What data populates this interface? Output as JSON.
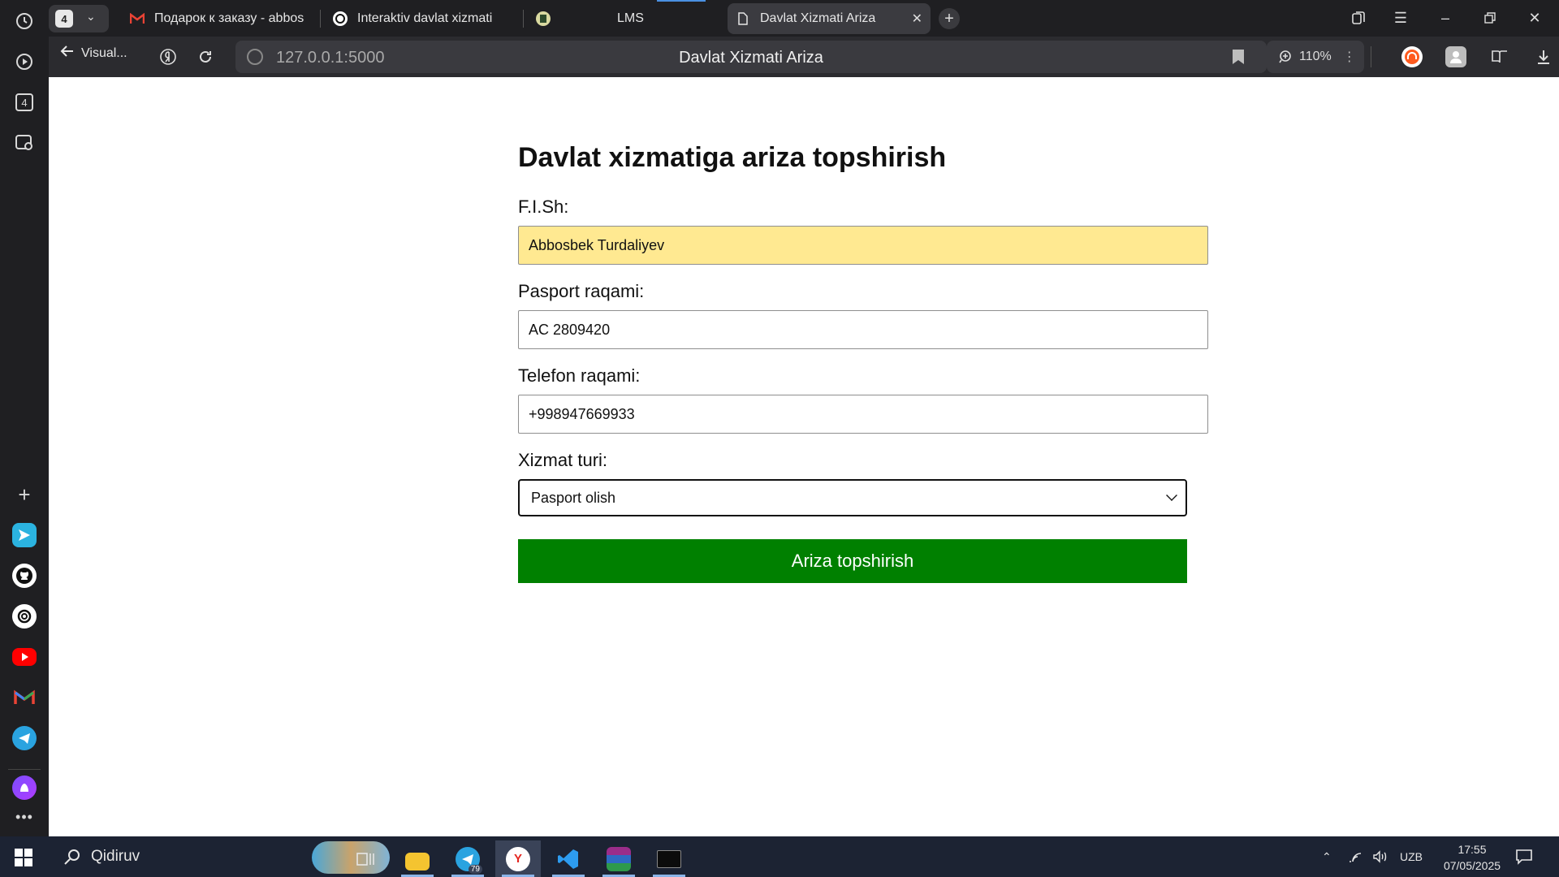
{
  "browser": {
    "tab_count": "4",
    "tabs": [
      {
        "title": "Подарок к заказу - abbos",
        "icon": "gmail-icon",
        "color": "#EA4335"
      },
      {
        "title": "Interaktiv davlat xizmati",
        "icon": "openai-icon",
        "color": "#ffffff"
      },
      {
        "title": "LMS",
        "icon": "lms-icon",
        "color": "#d9d9a0"
      },
      {
        "title": "Davlat Xizmati Ariza",
        "icon": "page-icon",
        "color": "#ffffff"
      }
    ],
    "back_label": "Visual...",
    "url": "127.0.0.1:5000",
    "page_title": "Davlat Xizmati Ariza",
    "zoom": "110%"
  },
  "sidebar": {
    "rail_badge": "4"
  },
  "form": {
    "title": "Davlat xizmatiga ariza topshirish",
    "fullname_label": "F.I.Sh:",
    "fullname_value": "Abbosbek Turdaliyev",
    "passport_label": "Pasport raqami:",
    "passport_value": "AC 2809420",
    "phone_label": "Telefon raqami:",
    "phone_value": "+998947669933",
    "service_label": "Xizmat turi:",
    "service_value": "Pasport olish",
    "submit_label": "Ariza topshirish",
    "submit_color": "#008000",
    "autofill_color": "#ffe991"
  },
  "taskbar": {
    "search_placeholder": "Qidiruv",
    "telegram_badge": "79",
    "language": "UZB",
    "time": "17:55",
    "date": "07/05/2025"
  }
}
